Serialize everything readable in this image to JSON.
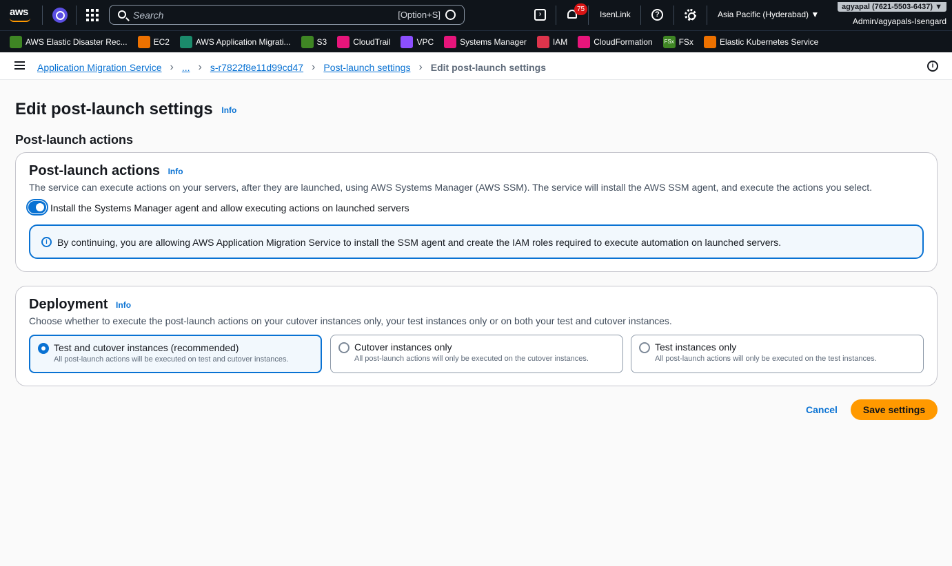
{
  "topnav": {
    "logo_text": "aws",
    "search": {
      "placeholder": "Search",
      "shortcut": "[Option+S]"
    },
    "notifications_count": "75",
    "isenlink": "IsenLink",
    "region": "Asia Pacific (Hyderabad) ▼",
    "account_id": "agyapal (7621-5503-6437) ▼",
    "role": "Admin/agyapals-Isengard"
  },
  "favorites": [
    {
      "label": "AWS Elastic Disaster Rec...",
      "color": "#3f8624",
      "icon": "drs-icon"
    },
    {
      "label": "EC2",
      "color": "#ed7100",
      "icon": "ec2-icon"
    },
    {
      "label": "AWS Application Migrati...",
      "color": "#1b8a6b",
      "icon": "mgn-icon"
    },
    {
      "label": "S3",
      "color": "#3f8624",
      "icon": "s3-icon"
    },
    {
      "label": "CloudTrail",
      "color": "#e7157b",
      "icon": "cloudtrail-icon"
    },
    {
      "label": "VPC",
      "color": "#8c4fff",
      "icon": "vpc-icon"
    },
    {
      "label": "Systems Manager",
      "color": "#e7157b",
      "icon": "ssm-icon"
    },
    {
      "label": "IAM",
      "color": "#dd344c",
      "icon": "iam-icon"
    },
    {
      "label": "CloudFormation",
      "color": "#e7157b",
      "icon": "cloudformation-icon"
    },
    {
      "label": "FSx",
      "color": "#3f8624",
      "icon": "fsx-icon",
      "icon_text": "FSx"
    },
    {
      "label": "Elastic Kubernetes Service",
      "color": "#ed7100",
      "icon": "eks-icon"
    }
  ],
  "breadcrumb": {
    "items": [
      "Application Migration Service",
      "...",
      "s-r7822f8e11d99cd47",
      "Post-launch settings"
    ],
    "current": "Edit post-launch settings"
  },
  "page": {
    "title": "Edit post-launch settings",
    "info": "Info",
    "section_heading": "Post-launch actions"
  },
  "post_launch": {
    "title": "Post-launch actions",
    "info": "Info",
    "description": "The service can execute actions on your servers, after they are launched, using AWS Systems Manager (AWS SSM). The service will install the AWS SSM agent, and execute the actions you select.",
    "toggle_label": "Install the Systems Manager agent and allow executing actions on launched servers",
    "toggle_on": true,
    "alert_text": "By continuing, you are allowing AWS Application Migration Service to install the SSM agent and create the IAM roles required to execute automation on launched servers."
  },
  "deployment": {
    "title": "Deployment",
    "info": "Info",
    "description": "Choose whether to execute the post-launch actions on your cutover instances only, your test instances only or on both your test and cutover instances.",
    "options": [
      {
        "label": "Test and cutover instances (recommended)",
        "description": "All post-launch actions will be executed on test and cutover instances.",
        "selected": true
      },
      {
        "label": "Cutover instances only",
        "description": "All post-launch actions will only be executed on the cutover instances.",
        "selected": false
      },
      {
        "label": "Test instances only",
        "description": "All post-launch actions will only be executed on the test instances.",
        "selected": false
      }
    ]
  },
  "actions": {
    "cancel": "Cancel",
    "save": "Save settings"
  },
  "colors": {
    "accent": "#0972d3",
    "primary_button": "#ff9900",
    "nav_bg": "#0f141a"
  }
}
